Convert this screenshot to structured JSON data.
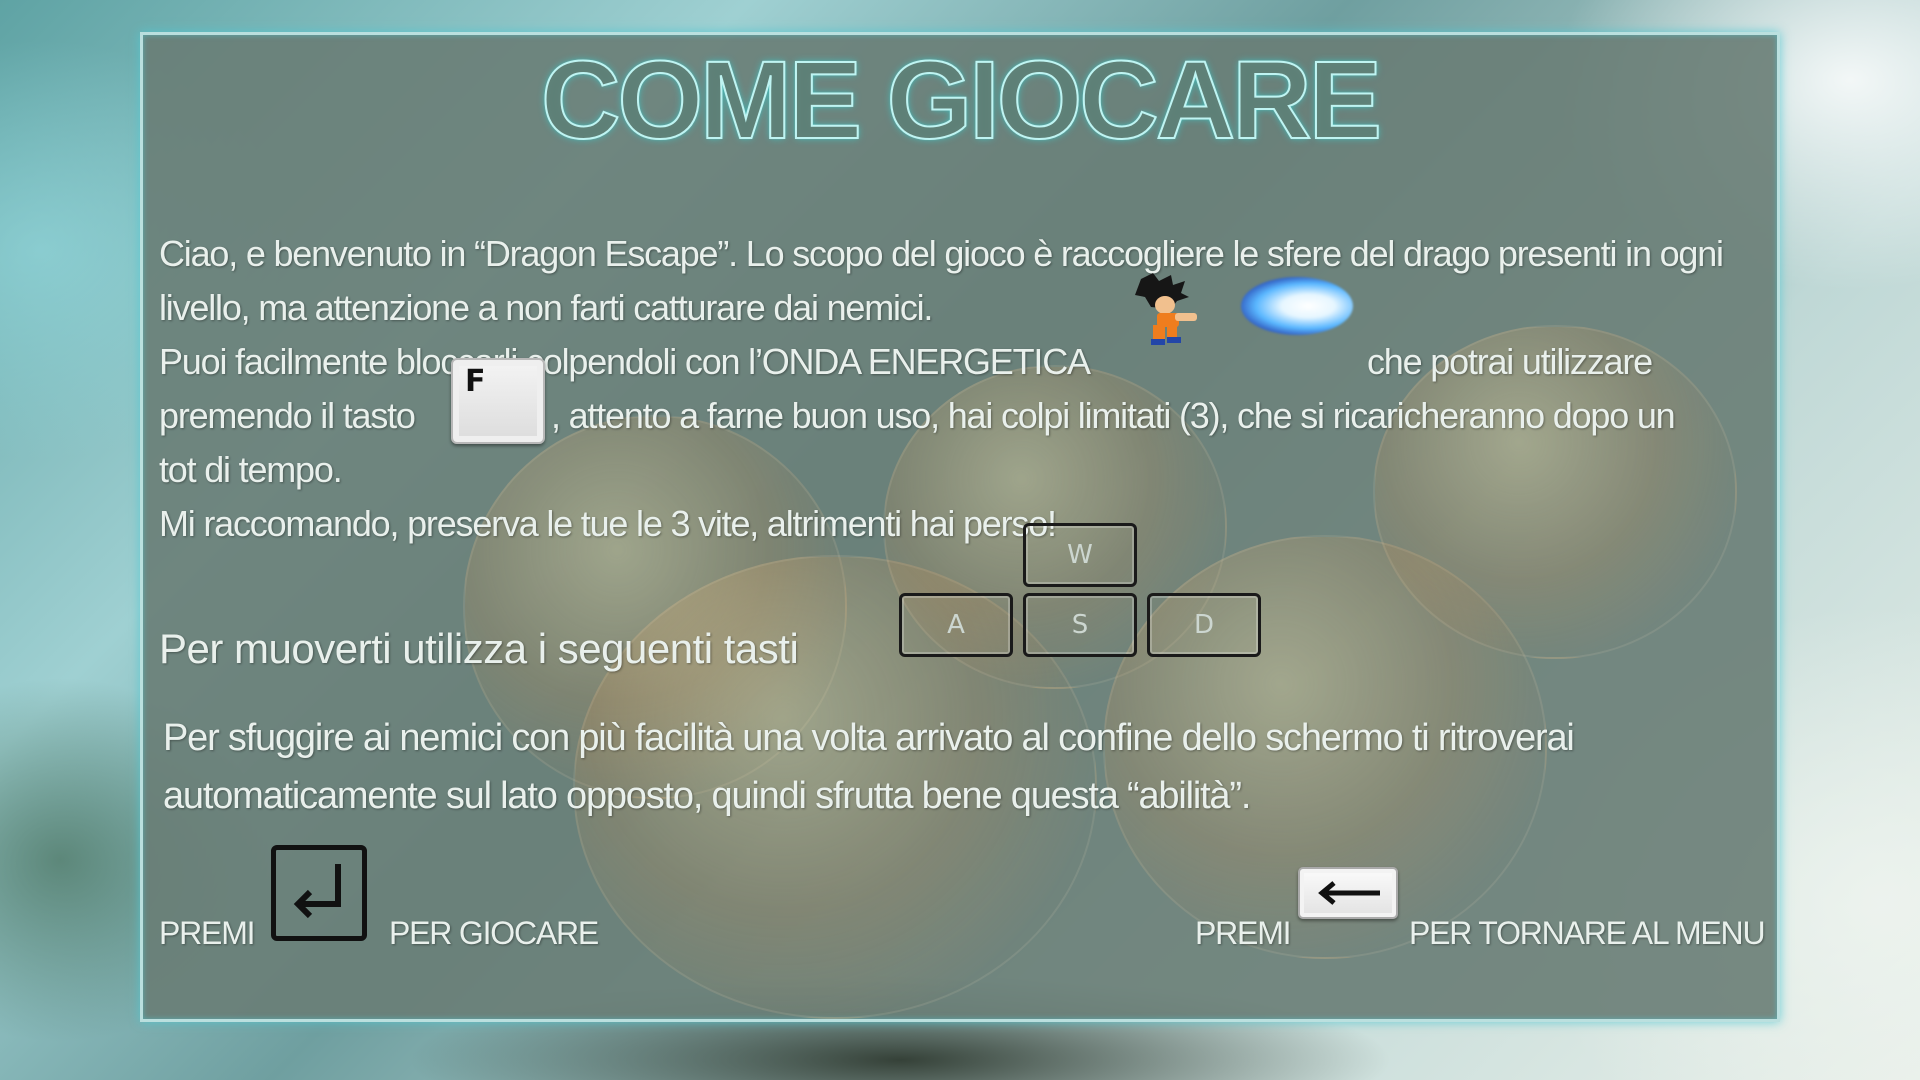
{
  "title": "COME GIOCARE",
  "intro": {
    "line1": "Ciao, e benvenuto in “Dragon Escape”. Lo scopo del gioco è raccogliere le sfere del drago presenti in ogni",
    "line2": "livello, ma attenzione a non farti catturare dai nemici.",
    "line3": "Puoi facilmente bloccarli colpendoli con l’ONDA ENERGETICA",
    "line3_end": "che potrai utilizzare",
    "line4_start": "premendo il tasto",
    "line4_end": ", attento a farne buon uso, hai colpi limitati (3), che si ricaricheranno dopo un",
    "line5": "tot di tempo.",
    "line6": "Mi raccomando, preserva le tue le 3 vite, altrimenti hai perso!"
  },
  "fire_key": "F",
  "movement": {
    "label": "Per muoverti utilizza i seguenti tasti",
    "keys": {
      "up": "W",
      "left": "A",
      "down": "S",
      "right": "D"
    }
  },
  "wrap": {
    "line1": "Per sfuggire ai nemici con più facilità una volta arrivato al confine dello schermo ti ritroverai",
    "line2": "automaticamente sul lato opposto, quindi sfrutta bene questa “abilità”."
  },
  "footer": {
    "play_prefix": "PREMI",
    "play_suffix": "PER GIOCARE",
    "menu_prefix": "PREMI",
    "menu_suffix": "PER TORNARE AL MENU"
  },
  "icons": {
    "enter": "enter-key-icon",
    "backspace": "backspace-key-icon",
    "character": "character-sprite-icon",
    "energy_wave": "energy-wave-icon"
  },
  "colors": {
    "title_glow": "#bff4f2",
    "panel": "#697d76",
    "text": "#e9f0ec"
  }
}
